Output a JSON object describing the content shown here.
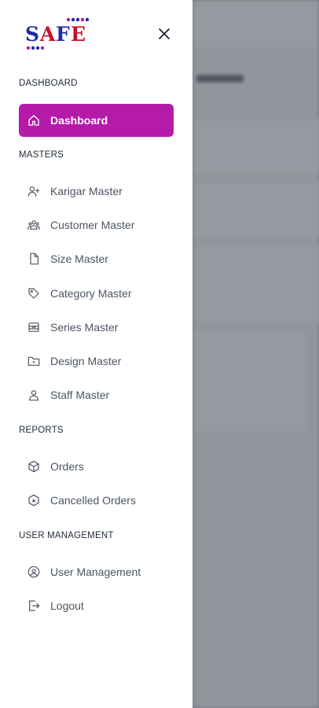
{
  "brand": {
    "logo_text": "SAFE",
    "accent": "#b51aa8",
    "logo_blue": "#1f2aa8",
    "logo_red": "#c8102e"
  },
  "sections": {
    "dashboard": {
      "title": "DASHBOARD"
    },
    "masters": {
      "title": "MASTERS"
    },
    "reports": {
      "title": "REPORTS"
    },
    "user_management": {
      "title": "USER MANAGEMENT"
    }
  },
  "nav": {
    "dashboard": {
      "label": "Dashboard",
      "icon": "home-icon",
      "active": true
    },
    "karigar": {
      "label": "Karigar Master",
      "icon": "user-plus-icon"
    },
    "customer": {
      "label": "Customer Master",
      "icon": "users-icon"
    },
    "size": {
      "label": "Size Master",
      "icon": "file-icon"
    },
    "category": {
      "label": "Category Master",
      "icon": "tag-icon"
    },
    "series": {
      "label": "Series Master",
      "icon": "layers-box-icon"
    },
    "design": {
      "label": "Design Master",
      "icon": "folder-icon"
    },
    "staff": {
      "label": "Staff Master",
      "icon": "user-icon"
    },
    "orders": {
      "label": "Orders",
      "icon": "box-icon"
    },
    "cancelled": {
      "label": "Cancelled Orders",
      "icon": "box-x-icon"
    },
    "user_mgmt": {
      "label": "User Management",
      "icon": "user-circle-icon"
    },
    "logout": {
      "label": "Logout",
      "icon": "logout-icon"
    }
  },
  "colors": {
    "active_bg": "#b51aa8",
    "text": "#4b5563",
    "section": "#1f2937"
  }
}
